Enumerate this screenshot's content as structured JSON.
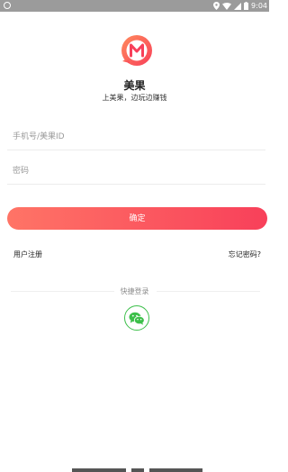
{
  "status_bar": {
    "time": "9:04",
    "icons": [
      "sync-icon",
      "location-icon",
      "wifi-icon",
      "signal-icon",
      "battery-icon"
    ]
  },
  "app": {
    "logo_icon": "meiguo-logo-icon",
    "name": "美果",
    "slogan": "上美果，边玩边赚钱"
  },
  "form": {
    "phone_placeholder": "手机号/美果ID",
    "password_placeholder": "密码",
    "phone_value": "",
    "password_value": "",
    "confirm_label": "确定"
  },
  "links": {
    "register": "用户注册",
    "forgot_password": "忘记密码?"
  },
  "quick_login": {
    "label": "快捷登录",
    "wechat_icon": "wechat-icon"
  },
  "colors": {
    "accent_start": "#ff7466",
    "accent_end": "#f8405a",
    "wechat_green": "#3cbf4a",
    "status_bar": "#9b9b9b"
  }
}
